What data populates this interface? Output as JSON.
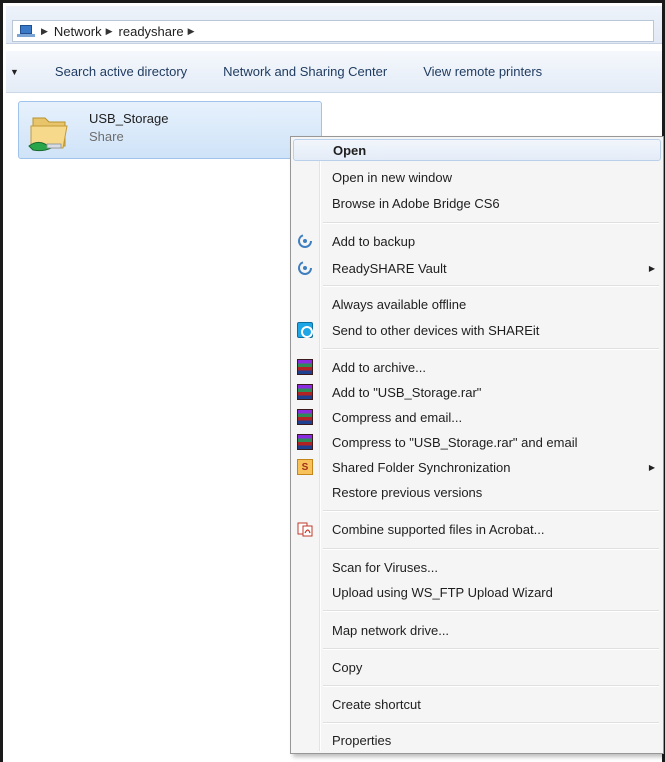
{
  "breadcrumb": {
    "items": [
      "Network",
      "readyshare"
    ]
  },
  "commandbar": {
    "items": [
      "Search active directory",
      "Network and Sharing Center",
      "View remote printers"
    ]
  },
  "folder": {
    "name": "USB_Storage",
    "subtitle": "Share"
  },
  "context_menu": {
    "open": "Open",
    "open_new_window": "Open in new window",
    "browse_bridge": "Browse in Adobe Bridge CS6",
    "add_to_backup": "Add to backup",
    "readyshare_vault": "ReadySHARE Vault",
    "always_offline": "Always available offline",
    "send_shareit": "Send to other devices with SHAREit",
    "add_to_archive": "Add to archive...",
    "add_to_rar": "Add to \"USB_Storage.rar\"",
    "compress_email": "Compress and email...",
    "compress_rar_email": "Compress to \"USB_Storage.rar\" and email",
    "shared_folder_sync": "Shared Folder Synchronization",
    "restore_versions": "Restore previous versions",
    "combine_acrobat": "Combine supported files in Acrobat...",
    "scan_viruses": "Scan for Viruses...",
    "upload_wsftp": "Upload using WS_FTP Upload Wizard",
    "map_drive": "Map network drive...",
    "copy": "Copy",
    "create_shortcut": "Create shortcut",
    "properties": "Properties"
  },
  "colors": {
    "accent": "#cfe3f8",
    "menu_bg": "#f5f5f5"
  }
}
